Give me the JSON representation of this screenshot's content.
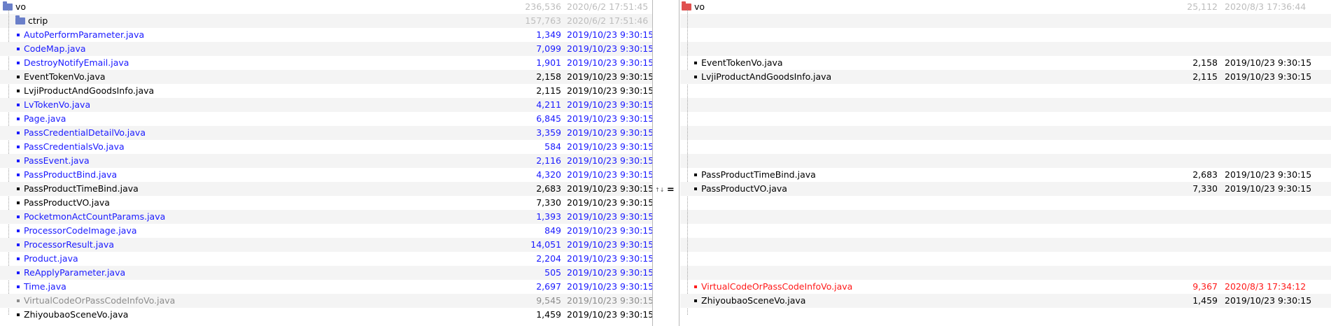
{
  "left": {
    "root": {
      "name": "vo",
      "size": "236,536",
      "date": "2020/6/2 17:51:45",
      "icon": "folder-open-icon",
      "color": "#6a7fc9"
    },
    "subfolder": {
      "name": "ctrip",
      "size": "157,763",
      "date": "2020/6/2 17:51:46",
      "icon": "folder-icon",
      "color": "#6a7fc9"
    },
    "files": [
      {
        "name": "AutoPerformParameter.java",
        "size": "1,349",
        "date": "2019/10/23 9:30:15",
        "status": "orphan"
      },
      {
        "name": "CodeMap.java",
        "size": "7,099",
        "date": "2019/10/23 9:30:15",
        "status": "orphan"
      },
      {
        "name": "DestroyNotifyEmail.java",
        "size": "1,901",
        "date": "2019/10/23 9:30:15",
        "status": "orphan"
      },
      {
        "name": "EventTokenVo.java",
        "size": "2,158",
        "date": "2019/10/23 9:30:15",
        "status": "same"
      },
      {
        "name": "LvjiProductAndGoodsInfo.java",
        "size": "2,115",
        "date": "2019/10/23 9:30:15",
        "status": "same"
      },
      {
        "name": "LvTokenVo.java",
        "size": "4,211",
        "date": "2019/10/23 9:30:15",
        "status": "orphan"
      },
      {
        "name": "Page.java",
        "size": "6,845",
        "date": "2019/10/23 9:30:15",
        "status": "orphan"
      },
      {
        "name": "PassCredentialDetailVo.java",
        "size": "3,359",
        "date": "2019/10/23 9:30:15",
        "status": "orphan"
      },
      {
        "name": "PassCredentialsVo.java",
        "size": "584",
        "date": "2019/10/23 9:30:15",
        "status": "orphan"
      },
      {
        "name": "PassEvent.java",
        "size": "2,116",
        "date": "2019/10/23 9:30:15",
        "status": "orphan"
      },
      {
        "name": "PassProductBind.java",
        "size": "4,320",
        "date": "2019/10/23 9:30:15",
        "status": "orphan"
      },
      {
        "name": "PassProductTimeBind.java",
        "size": "2,683",
        "date": "2019/10/23 9:30:15",
        "status": "same"
      },
      {
        "name": "PassProductVO.java",
        "size": "7,330",
        "date": "2019/10/23 9:30:15",
        "status": "same"
      },
      {
        "name": "PocketmonActCountParams.java",
        "size": "1,393",
        "date": "2019/10/23 9:30:15",
        "status": "orphan"
      },
      {
        "name": "ProcessorCodeImage.java",
        "size": "849",
        "date": "2019/10/23 9:30:15",
        "status": "orphan"
      },
      {
        "name": "ProcessorResult.java",
        "size": "14,051",
        "date": "2019/10/23 9:30:15",
        "status": "orphan"
      },
      {
        "name": "Product.java",
        "size": "2,204",
        "date": "2019/10/23 9:30:15",
        "status": "orphan"
      },
      {
        "name": "ReApplyParameter.java",
        "size": "505",
        "date": "2019/10/23 9:30:15",
        "status": "orphan"
      },
      {
        "name": "Time.java",
        "size": "2,697",
        "date": "2019/10/23 9:30:15",
        "status": "orphan"
      },
      {
        "name": "VirtualCodeOrPassCodeInfoVo.java",
        "size": "9,545",
        "date": "2019/10/23 9:30:15",
        "status": "older"
      },
      {
        "name": "ZhiyoubaoSceneVo.java",
        "size": "1,459",
        "date": "2019/10/23 9:30:15",
        "status": "same"
      }
    ]
  },
  "right": {
    "root": {
      "name": "vo",
      "size": "25,112",
      "date": "2020/8/3 17:36:44",
      "icon": "folder-open-icon",
      "color": "#e0504f"
    },
    "files": [
      {
        "row": 5,
        "name": "EventTokenVo.java",
        "size": "2,158",
        "date": "2019/10/23 9:30:15",
        "status": "same"
      },
      {
        "row": 6,
        "name": "LvjiProductAndGoodsInfo.java",
        "size": "2,115",
        "date": "2019/10/23 9:30:15",
        "status": "same"
      },
      {
        "row": 13,
        "name": "PassProductTimeBind.java",
        "size": "2,683",
        "date": "2019/10/23 9:30:15",
        "status": "same"
      },
      {
        "row": 14,
        "name": "PassProductVO.java",
        "size": "7,330",
        "date": "2019/10/23 9:30:15",
        "status": "same"
      },
      {
        "row": 21,
        "name": "VirtualCodeOrPassCodeInfoVo.java",
        "size": "9,367",
        "date": "2020/8/3 17:34:12",
        "status": "newer"
      },
      {
        "row": 22,
        "name": "ZhiyoubaoSceneVo.java",
        "size": "1,459",
        "date": "2019/10/23 9:30:15",
        "status": "same"
      }
    ]
  },
  "middle": {
    "marker_small": "↑↓",
    "marker_eq": "="
  },
  "colors": {
    "orphan": "#1a1aff",
    "same": "#000000",
    "older": "#8c8c8c",
    "newer": "#ff1a1a",
    "folder_meta": "#bdbdbd"
  }
}
